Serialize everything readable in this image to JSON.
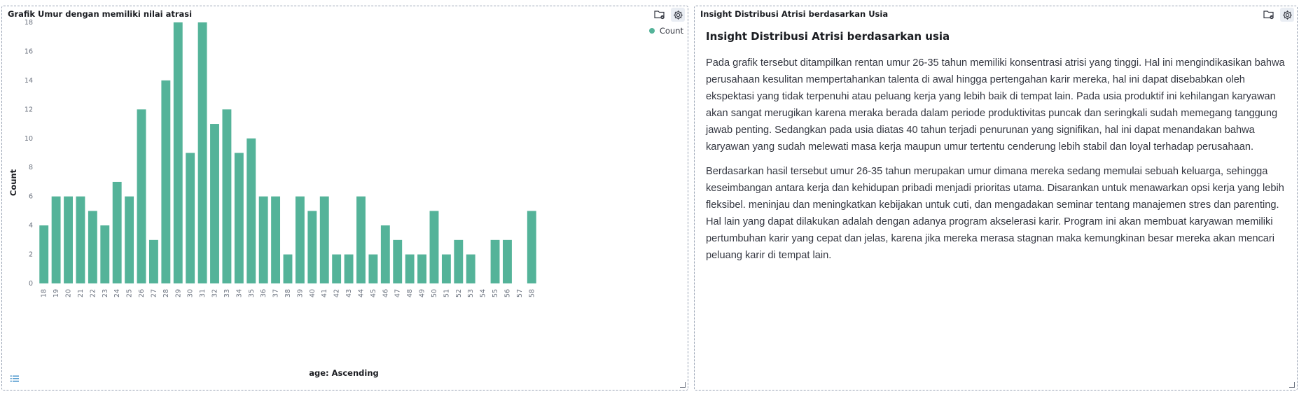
{
  "left_panel": {
    "title": "Grafik Umur dengan memiliki nilai atrasi"
  },
  "right_panel": {
    "title": "Insight Distribusi Atrisi berdasarkan Usia",
    "heading": "Insight Distribusi Atrisi berdasarkan usia",
    "paragraph1": "Pada grafik tersebut ditampilkan rentan umur 26-35 tahun memiliki konsentrasi atrisi yang tinggi. Hal ini mengindikasikan bahwa perusahaan kesulitan mempertahankan talenta di awal hingga pertengahan karir mereka, hal ini dapat disebabkan oleh ekspektasi yang tidak terpenuhi atau peluang kerja yang lebih baik di tempat lain. Pada usia produktif ini kehilangan karyawan akan sangat merugikan karena meraka berada dalam periode produktivitas puncak dan seringkali sudah memegang tanggung jawab penting. Sedangkan pada usia diatas 40 tahun terjadi penurunan yang signifikan, hal ini dapat menandakan bahwa karyawan yang sudah melewati masa kerja maupun umur tertentu cenderung lebih stabil dan loyal terhadap perusahaan.",
    "paragraph2": "Berdasarkan hasil tersebut umur 26-35 tahun merupakan umur dimana mereka sedang memulai sebuah keluarga, sehingga keseimbangan antara kerja dan kehidupan pribadi menjadi prioritas utama. Disarankan untuk menawarkan opsi kerja yang lebih fleksibel. meninjau dan meningkatkan kebijakan untuk cuti, dan mengadakan seminar tentang manajemen stres dan parenting. Hal lain yang dapat dilakukan adalah dengan adanya program akselerasi karir. Program ini akan membuat karyawan memiliki pertumbuhan karir yang cepat dan jelas, karena jika mereka merasa stagnan maka kemungkinan besar mereka akan mencari peluang karir di tempat lain."
  },
  "icons": {
    "folder": "folder-check-icon",
    "settings": "gear-icon",
    "legend": "list-icon"
  },
  "colors": {
    "bar": "#54b399",
    "border": "#98a2b3"
  },
  "chart_data": {
    "type": "bar",
    "xlabel": "age: Ascending",
    "ylabel": "Count",
    "ylim": [
      0,
      18
    ],
    "yticks": [
      0,
      2,
      4,
      6,
      8,
      10,
      12,
      14,
      16,
      18
    ],
    "grid": false,
    "legend": "top-right",
    "categories": [
      "18",
      "19",
      "20",
      "21",
      "22",
      "23",
      "24",
      "25",
      "26",
      "27",
      "28",
      "29",
      "30",
      "31",
      "32",
      "33",
      "34",
      "35",
      "36",
      "37",
      "38",
      "39",
      "40",
      "41",
      "42",
      "43",
      "44",
      "45",
      "46",
      "47",
      "48",
      "49",
      "50",
      "51",
      "52",
      "53",
      "54",
      "55",
      "56",
      "57",
      "58"
    ],
    "series": [
      {
        "name": "Count",
        "values": [
          4,
          6,
          6,
          6,
          5,
          4,
          7,
          6,
          12,
          3,
          14,
          18,
          9,
          18,
          11,
          12,
          9,
          10,
          6,
          6,
          2,
          6,
          5,
          6,
          2,
          2,
          6,
          2,
          4,
          3,
          2,
          2,
          5,
          2,
          3,
          2,
          0,
          3,
          3,
          0,
          5
        ]
      }
    ]
  }
}
